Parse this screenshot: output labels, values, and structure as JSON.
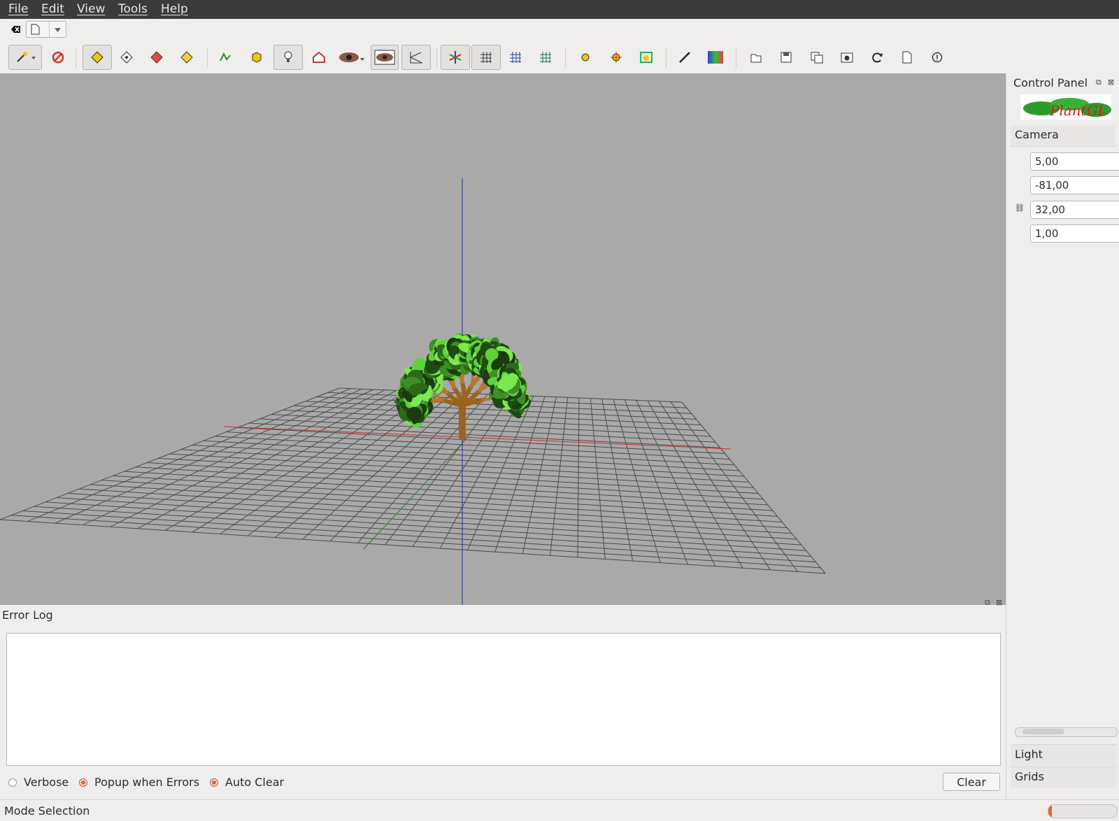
{
  "menubar": {
    "items": [
      {
        "label": "File"
      },
      {
        "label": "Edit"
      },
      {
        "label": "View"
      },
      {
        "label": "Tools"
      },
      {
        "label": "Help"
      }
    ]
  },
  "tabbar": {
    "close_icon": "close-tab-icon",
    "document_icon": "document-icon",
    "dropdown_icon": "chevron-down-icon"
  },
  "toolbar": {
    "buttons": [
      "selection-wand-icon",
      "no-rotation-icon",
      "rotate-icon",
      "fly-icon",
      "walk-icon",
      "rect-select-icon",
      "curve-icon",
      "cube-icon",
      "light-bulb-icon",
      "home-icon",
      "eye-dropdown-icon",
      "eye-icon",
      "perspective-icon",
      "axes-icon",
      "grid-xy-icon",
      "grid-xz-icon",
      "grid-yz-icon",
      "point-icon",
      "crosshair-icon",
      "bounding-box-icon",
      "line-icon",
      "color-map-icon",
      "open-file-icon",
      "save-icon",
      "copy-icon",
      "screenshot-icon",
      "refresh-icon",
      "new-file-icon",
      "info-icon"
    ]
  },
  "control_panel": {
    "title": "Control Panel",
    "logo_text": "PlantGL",
    "camera": {
      "header": "Camera",
      "values": [
        "5,00",
        "-81,00",
        "32,00",
        "1,00"
      ]
    },
    "sections": [
      "Light",
      "Grids"
    ]
  },
  "error_log": {
    "title": "Error Log",
    "content": "",
    "options": [
      {
        "label": "Verbose",
        "checked": false
      },
      {
        "label": "Popup when Errors",
        "checked": true
      },
      {
        "label": "Auto Clear",
        "checked": true
      }
    ],
    "clear_label": "Clear"
  },
  "status": {
    "text": "Mode Selection",
    "progress": 0.05
  },
  "colors": {
    "accent": "#e0633a",
    "viewport_bg": "#a9a9a9",
    "menubar_bg": "#3c3b37"
  }
}
